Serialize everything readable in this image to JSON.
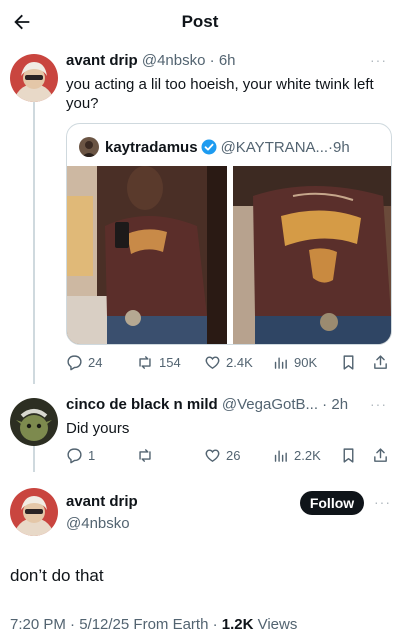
{
  "header": {
    "title": "Post"
  },
  "reply1": {
    "name": "avant drip",
    "handle": "@4nbsko",
    "time": "6h",
    "text": "you acting a lil too hoeish, your white twink left you?",
    "more": "···"
  },
  "quote": {
    "name": "kaytradamus",
    "handle": "@KAYTRANA...",
    "time": "9h"
  },
  "reply1_actions": {
    "replies": "24",
    "reposts": "154",
    "likes": "2.4K",
    "views": "90K"
  },
  "reply2": {
    "name": "cinco de black n mild",
    "handle": "@VegaGotB...",
    "time": "2h",
    "text": "Did yours",
    "more": "···"
  },
  "reply2_actions": {
    "replies": "1",
    "reposts": "",
    "likes": "26",
    "views": "2.2K"
  },
  "main": {
    "name": "avant drip",
    "handle": "@4nbsko",
    "follow_label": "Follow",
    "more": "···",
    "text": "don’t do that",
    "timestamp": "7:20 PM · 5/12/25 From Earth · ",
    "views_count": "1.2K",
    "views_label": " Views"
  },
  "colors": {
    "text": "#0f1419",
    "secondary": "#536471",
    "border": "#cfd9de",
    "verified": "#1d9bf0"
  }
}
